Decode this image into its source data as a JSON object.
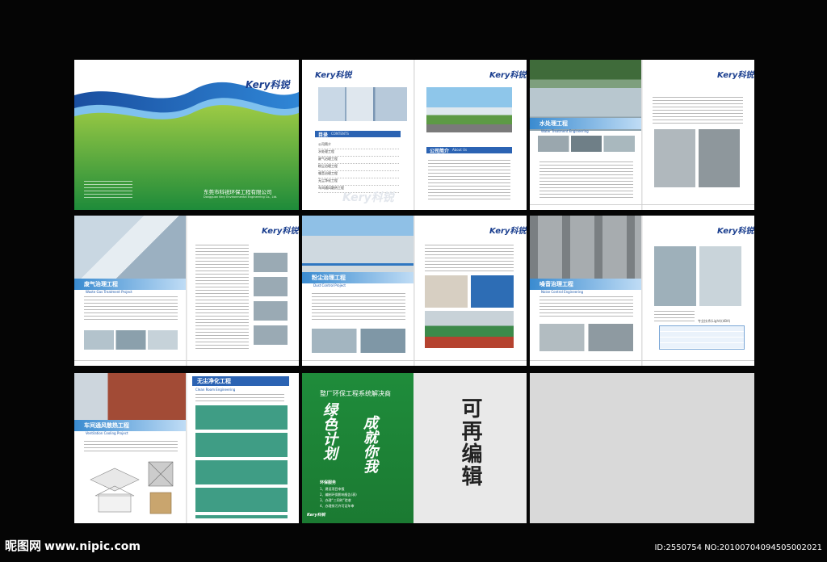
{
  "brand": {
    "logo_text": "Kery科锐"
  },
  "cover": {
    "company_cn": "东莞市科锐环保工程有限公司",
    "company_en": "Dongguan Kery Environmental Engineering Co., Ltd."
  },
  "toc": {
    "title": "目录",
    "title_en": "CONTENTS",
    "items": [
      "公司简介",
      "水处理工程",
      "废气治理工程",
      "粉尘治理工程",
      "噪音治理工程",
      "无尘净化工程",
      "车间通风散热工程"
    ]
  },
  "page2": {
    "intro_title": "公司简介",
    "intro_title_en": "About Us"
  },
  "page3": {
    "banner": "水处理工程",
    "banner_en": "Water Treatment Engineering"
  },
  "page4": {
    "banner": "废气治理工程",
    "banner_en": "Waste Gas Treatment Project"
  },
  "page5": {
    "banner": "粉尘治理工程",
    "banner_en": "Dust Control Project"
  },
  "page6": {
    "banner": "噪音治理工程",
    "banner_en": "Noise Control Engineering",
    "table_title": "专业技术(Light)(dBA)"
  },
  "page7": {
    "banner": "车间通风散热工程",
    "banner_en": "Ventilation Cooling Project",
    "banner_right": "无尘净化工程",
    "banner_right_en": "Clean Room Engineering"
  },
  "back_cover": {
    "headline": "整厂环保工程系统解决商",
    "slogan_1": "绿色计划",
    "slogan_2": "成就你我",
    "services_title": "环保服务",
    "services": [
      "1、建设项目申报",
      "2、编制环保影响报告(表)",
      "3、办理“三同时”验收",
      "4、办理排污许可证年审"
    ],
    "editable_note": "可再编辑"
  },
  "watermark": {
    "site_cn": "昵图网",
    "site_url": "www.nipic.com",
    "id_text": "ID:2550754 NO:20100704094505002021"
  },
  "colors": {
    "background": "#050505",
    "accent_blue": "#1d57a8",
    "accent_green": "#1f8c3b",
    "panel_gray": "#d9d9d9"
  }
}
